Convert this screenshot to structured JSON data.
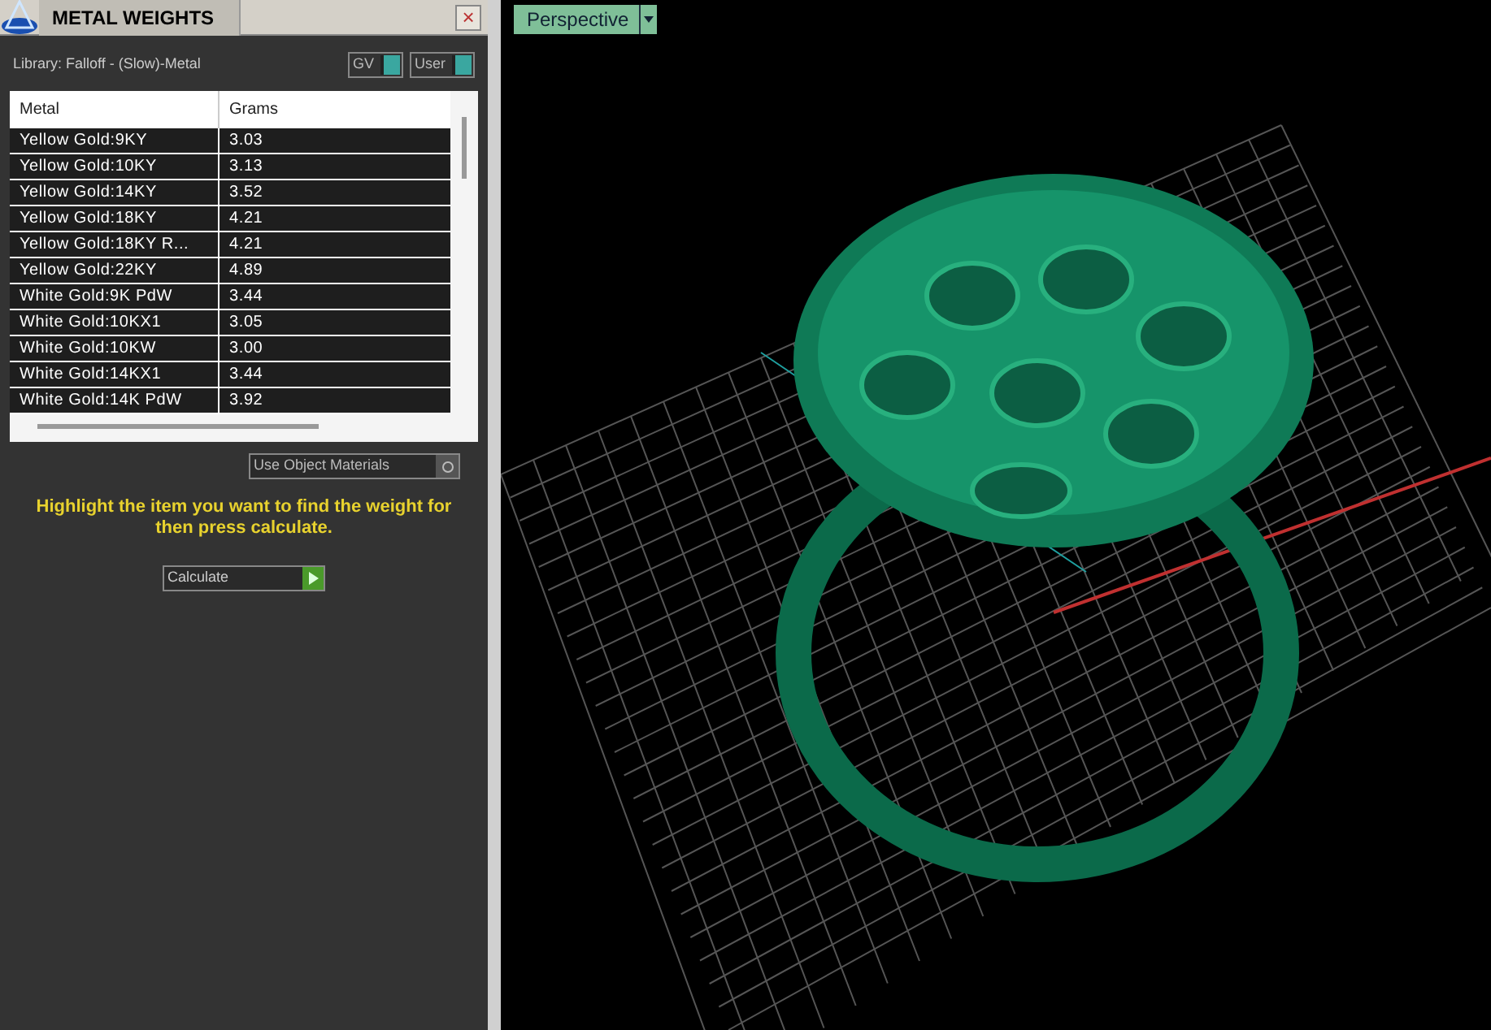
{
  "panel": {
    "title": "METAL WEIGHTS",
    "close": "×",
    "library": "Library: Falloff - (Slow)-Metal",
    "toggles": [
      {
        "label": "GV",
        "on": true
      },
      {
        "label": "User",
        "on": true
      }
    ],
    "table": {
      "columns": [
        "Metal",
        "Grams"
      ],
      "rows": [
        [
          "Yellow Gold:9KY",
          "3.03"
        ],
        [
          "Yellow Gold:10KY",
          "3.13"
        ],
        [
          "Yellow Gold:14KY",
          "3.52"
        ],
        [
          "Yellow Gold:18KY",
          "4.21"
        ],
        [
          "Yellow Gold:18KY R...",
          "4.21"
        ],
        [
          "Yellow Gold:22KY",
          "4.89"
        ],
        [
          "White Gold:9K PdW",
          "3.44"
        ],
        [
          "White Gold:10KX1",
          "3.05"
        ],
        [
          "White Gold:10KW",
          "3.00"
        ],
        [
          "White Gold:14KX1",
          "3.44"
        ],
        [
          "White Gold:14K PdW",
          "3.92"
        ]
      ]
    },
    "use_object_materials": {
      "label": "Use Object Materials"
    },
    "hint": "Highlight the item you want to find the weight for then press calculate.",
    "calculate": "Calculate"
  },
  "viewport": {
    "label": "Perspective"
  }
}
